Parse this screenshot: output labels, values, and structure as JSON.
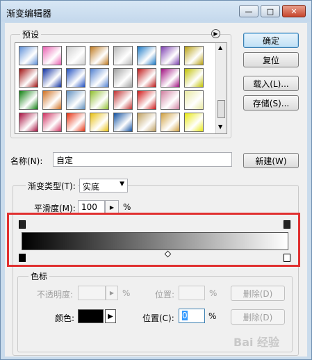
{
  "window": {
    "title": "渐变编辑器",
    "minimize": "—",
    "maximize": "□",
    "close": "✕"
  },
  "presets": {
    "label": "预设",
    "menu_icon": "circle-arrow-icon",
    "swatches": [
      [
        "#5d8fd8",
        "#e85fb0",
        "#cfcfcf",
        "#c07a20",
        "#b8b8b8",
        "#1c7ac8",
        "#7d3fb0",
        "#b8a010"
      ],
      [
        "#a01010",
        "#1030a0",
        "#2050c0",
        "#5080d0",
        "#a0a0a0",
        "#c01818",
        "#a01080",
        "#c0c000"
      ],
      [
        "#108010",
        "#d07020",
        "#6090c0",
        "#90c030",
        "#c03030",
        "#d01818",
        "#d080a0",
        "#e8e8a0"
      ],
      [
        "#a81040",
        "#d03060",
        "#e83010",
        "#e8c010",
        "#1050a0",
        "#c0a060",
        "#d0a040",
        "#e8e810"
      ]
    ]
  },
  "buttons": {
    "ok": "确定",
    "reset": "复位",
    "load": "载入(L)...",
    "save": "存储(S)...",
    "new": "新建(W)"
  },
  "name": {
    "label": "名称(N):",
    "value": "自定"
  },
  "gradient_type": {
    "label": "渐变类型(T):",
    "value": "实底"
  },
  "smoothness": {
    "label": "平滑度(M):",
    "value": "100",
    "unit": "%"
  },
  "color_stops": {
    "group_label": "色标",
    "opacity_label": "不透明度:",
    "opacity_unit": "%",
    "location_label_top": "位置:",
    "location_unit_top": "%",
    "delete_top": "删除(D)",
    "color_label": "颜色:",
    "color_value": "#000000",
    "location_label": "位置(C):",
    "location_value": "0",
    "location_unit": "%",
    "delete_bottom": "删除(D)"
  },
  "watermark": "Bai 经验"
}
